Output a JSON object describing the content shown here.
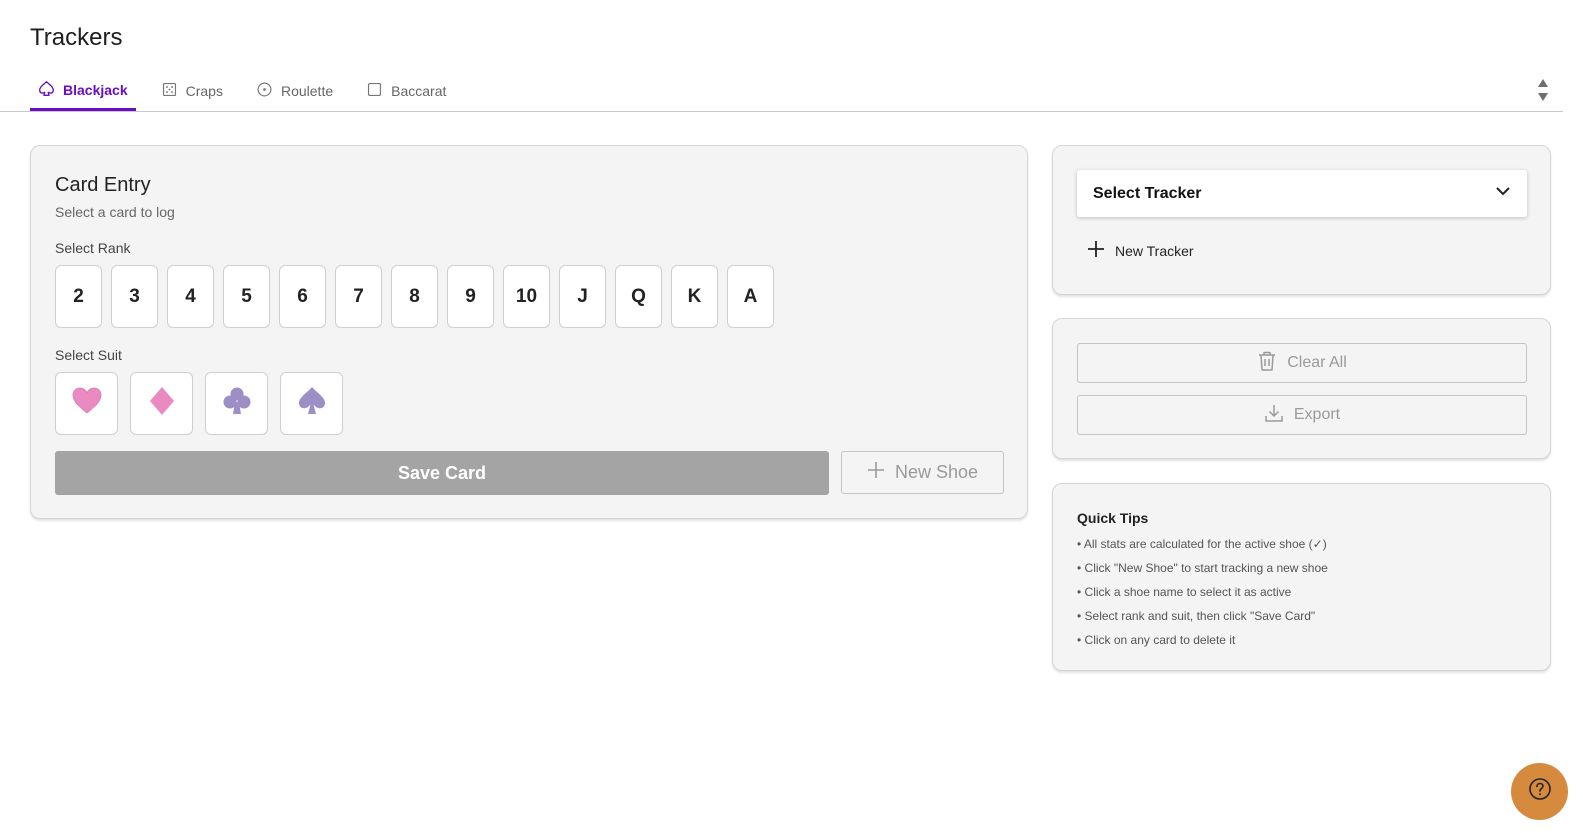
{
  "page": {
    "title": "Trackers"
  },
  "tabs": [
    {
      "label": "Blackjack",
      "icon": "spade-outline-icon",
      "active": true
    },
    {
      "label": "Craps",
      "icon": "dice-icon",
      "active": false
    },
    {
      "label": "Roulette",
      "icon": "roulette-icon",
      "active": false
    },
    {
      "label": "Baccarat",
      "icon": "square-icon",
      "active": false
    }
  ],
  "entry": {
    "title": "Card Entry",
    "subtitle": "Select a card to log",
    "rank_label": "Select Rank",
    "ranks": [
      "2",
      "3",
      "4",
      "5",
      "6",
      "7",
      "8",
      "9",
      "10",
      "J",
      "Q",
      "K",
      "A"
    ],
    "suit_label": "Select Suit",
    "suits": [
      {
        "name": "hearts",
        "icon": "heart-icon",
        "color": "#e98bc1"
      },
      {
        "name": "diamonds",
        "icon": "diamond-icon",
        "color": "#e98bc1"
      },
      {
        "name": "clubs",
        "icon": "club-icon",
        "color": "#9d8fc6"
      },
      {
        "name": "spades",
        "icon": "spade-icon",
        "color": "#9d8fc6"
      }
    ],
    "save_label": "Save Card",
    "new_shoe_label": "New Shoe"
  },
  "tracker": {
    "select_label": "Select Tracker",
    "new_tracker_label": "New Tracker"
  },
  "actions": {
    "clear_label": "Clear All",
    "export_label": "Export"
  },
  "tips": {
    "title": "Quick Tips",
    "items": [
      "• All stats are calculated for the active shoe (✓)",
      "• Click \"New Shoe\" to start tracking a new shoe",
      "• Click a shoe name to select it as active",
      "• Select rank and suit, then click \"Save Card\"",
      "• Click on any card to delete it"
    ]
  },
  "colors": {
    "accent": "#6a0dc4",
    "save_disabled": "#a4a4a4",
    "help_button": "#d58a3e",
    "card_bg": "#f4f4f4"
  }
}
